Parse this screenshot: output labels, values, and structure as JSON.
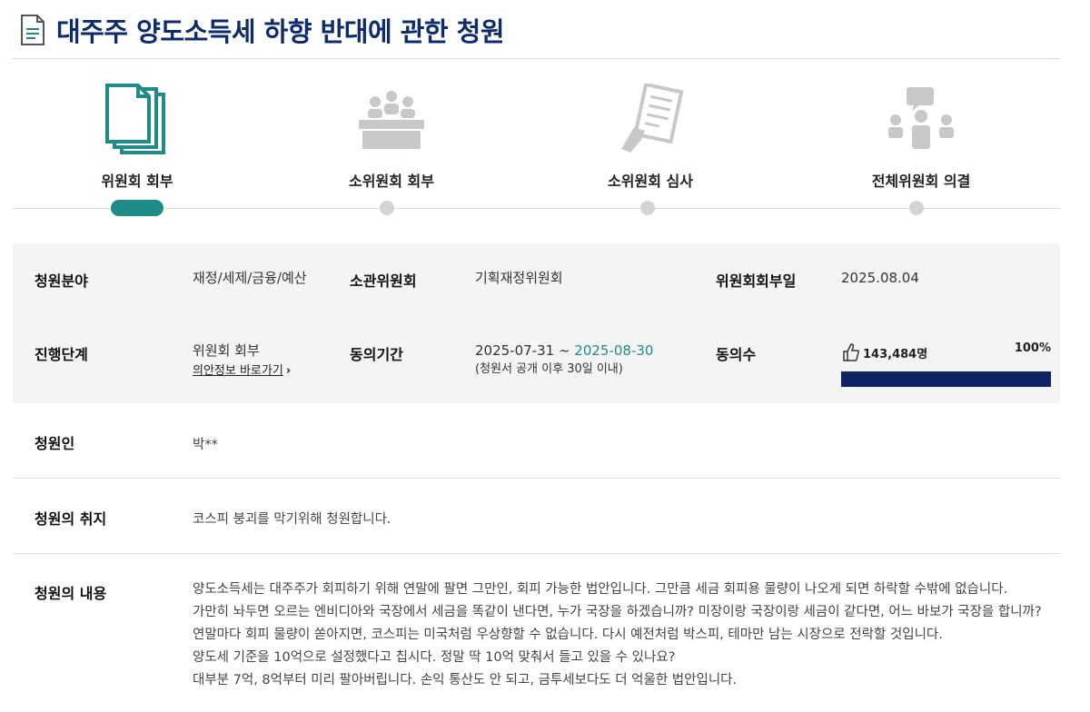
{
  "title": "대주주 양도소득세 하향 반대에 관한 청원",
  "steps": [
    {
      "label": "위원회 회부",
      "icon": "documents-icon",
      "active": true
    },
    {
      "label": "소위원회 회부",
      "icon": "meeting-table-icon",
      "active": false
    },
    {
      "label": "소위원회 심사",
      "icon": "review-hand-document-icon",
      "active": false
    },
    {
      "label": "전체위원회 의결",
      "icon": "group-discussion-icon",
      "active": false
    }
  ],
  "colors": {
    "accent": "#1e8b86",
    "navy": "#0e2266",
    "inactive": "#c8c8c8"
  },
  "info": {
    "field_label": "청원분야",
    "field_value": "재정/세제/금융/예산",
    "committee_label": "소관위원회",
    "committee_value": "기획재정위원회",
    "referral_date_label": "위원회회부일",
    "referral_date_value": "2025.08.04",
    "stage_label": "진행단계",
    "stage_value": "위원회 회부",
    "bill_link": "의안정보 바로가기",
    "period_label": "동의기간",
    "period_start": "2025-07-31",
    "period_sep": " ~ ",
    "period_end": "2025-08-30",
    "period_note": "(청원서 공개 이후 30일 이내)",
    "agree_label": "동의수",
    "agree_count": "143,484명",
    "agree_percent": "100%",
    "agree_progress": 1.0
  },
  "petitioner_label": "청원인",
  "petitioner_value": "박**",
  "purpose_label": "청원의 취지",
  "purpose_value": "코스피 붕괴를 막기위해 청원합니다.",
  "content_label": "청원의 내용",
  "content_lines": [
    "양도소득세는 대주주가 회피하기 위해 연말에 팔면 그만인, 회피 가능한 법안입니다. 그만큼 세금 회피용 물량이 나오게 되면 하락할 수밖에 없습니다.",
    "가만히 놔두면 오르는 엔비디아와 국장에서 세금을 똑같이 낸다면, 누가 국장을 하겠습니까? 미장이랑 국장이랑 세금이 같다면, 어느 바보가 국장을 합니까?",
    "연말마다 회피 물량이 쏟아지면, 코스피는 미국처럼 우상향할 수 없습니다. 다시 예전처럼 박스피, 테마만 남는 시장으로 전락할 것입니다.",
    "",
    "양도세 기준을 10억으로 설정했다고 칩시다. 정말 딱 10억 맞춰서 들고 있을 수 있나요?",
    "대부분 7억, 8억부터 미리 팔아버립니다. 손익 통산도 안 되고, 금투세보다도 더 억울한 법안입니다."
  ]
}
